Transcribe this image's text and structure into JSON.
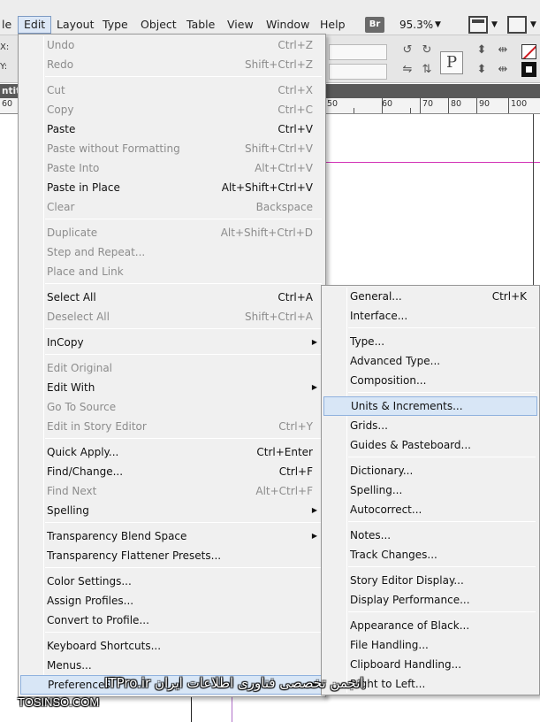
{
  "menubar": {
    "items": [
      {
        "label": "le",
        "active": false
      },
      {
        "label": "Edit",
        "active": true
      },
      {
        "label": "Layout",
        "active": false
      },
      {
        "label": "Type",
        "active": false
      },
      {
        "label": "Object",
        "active": false
      },
      {
        "label": "Table",
        "active": false
      },
      {
        "label": "View",
        "active": false
      },
      {
        "label": "Window",
        "active": false
      },
      {
        "label": "Help",
        "active": false
      }
    ],
    "bridge_badge": "Br",
    "zoom": "95.3%",
    "zoom_caret": "▼",
    "view_options_icon": "view-options-icon",
    "screen_mode_icon": "screen-mode-icon"
  },
  "control_panel": {
    "x_label": "X:",
    "y_label": "Y:",
    "fill_swatch_icon": "fill-none-icon",
    "stroke_swatch_icon": "stroke-black-icon",
    "paragraph_icon": "P"
  },
  "document": {
    "tab_label": "ntitle",
    "ruler_labels": [
      "60",
      "50",
      "60",
      "70",
      "80",
      "90",
      "100"
    ]
  },
  "edit_menu": {
    "items": [
      {
        "label": "Undo",
        "shortcut": "Ctrl+Z",
        "enabled": false
      },
      {
        "label": "Redo",
        "shortcut": "Shift+Ctrl+Z",
        "enabled": false
      },
      {
        "sep": true
      },
      {
        "label": "Cut",
        "shortcut": "Ctrl+X",
        "enabled": false
      },
      {
        "label": "Copy",
        "shortcut": "Ctrl+C",
        "enabled": false
      },
      {
        "label": "Paste",
        "shortcut": "Ctrl+V",
        "enabled": true
      },
      {
        "label": "Paste without Formatting",
        "shortcut": "Shift+Ctrl+V",
        "enabled": false
      },
      {
        "label": "Paste Into",
        "shortcut": "Alt+Ctrl+V",
        "enabled": false
      },
      {
        "label": "Paste in Place",
        "shortcut": "Alt+Shift+Ctrl+V",
        "enabled": true
      },
      {
        "label": "Clear",
        "shortcut": "Backspace",
        "enabled": false
      },
      {
        "sep": true
      },
      {
        "label": "Duplicate",
        "shortcut": "Alt+Shift+Ctrl+D",
        "enabled": false
      },
      {
        "label": "Step and Repeat...",
        "shortcut": "",
        "enabled": false
      },
      {
        "label": "Place and Link",
        "shortcut": "",
        "enabled": false
      },
      {
        "sep": true
      },
      {
        "label": "Select All",
        "shortcut": "Ctrl+A",
        "enabled": true
      },
      {
        "label": "Deselect All",
        "shortcut": "Shift+Ctrl+A",
        "enabled": false
      },
      {
        "sep": true
      },
      {
        "label": "InCopy",
        "shortcut": "",
        "enabled": true,
        "submenu": true
      },
      {
        "sep": true
      },
      {
        "label": "Edit Original",
        "shortcut": "",
        "enabled": false
      },
      {
        "label": "Edit With",
        "shortcut": "",
        "enabled": true,
        "submenu": true
      },
      {
        "label": "Go To Source",
        "shortcut": "",
        "enabled": false
      },
      {
        "label": "Edit in Story Editor",
        "shortcut": "Ctrl+Y",
        "enabled": false
      },
      {
        "sep": true
      },
      {
        "label": "Quick Apply...",
        "shortcut": "Ctrl+Enter",
        "enabled": true
      },
      {
        "label": "Find/Change...",
        "shortcut": "Ctrl+F",
        "enabled": true
      },
      {
        "label": "Find Next",
        "shortcut": "Alt+Ctrl+F",
        "enabled": false
      },
      {
        "label": "Spelling",
        "shortcut": "",
        "enabled": true,
        "submenu": true
      },
      {
        "sep": true
      },
      {
        "label": "Transparency Blend Space",
        "shortcut": "",
        "enabled": true,
        "submenu": true
      },
      {
        "label": "Transparency Flattener Presets...",
        "shortcut": "",
        "enabled": true
      },
      {
        "sep": true
      },
      {
        "label": "Color Settings...",
        "shortcut": "",
        "enabled": true
      },
      {
        "label": "Assign Profiles...",
        "shortcut": "",
        "enabled": true
      },
      {
        "label": "Convert to Profile...",
        "shortcut": "",
        "enabled": true
      },
      {
        "sep": true
      },
      {
        "label": "Keyboard Shortcuts...",
        "shortcut": "",
        "enabled": true
      },
      {
        "label": "Menus...",
        "shortcut": "",
        "enabled": true
      },
      {
        "label": "Preferences",
        "shortcut": "",
        "enabled": true,
        "submenu": true,
        "highlight": true
      }
    ]
  },
  "prefs_menu": {
    "items": [
      {
        "label": "General...",
        "shortcut": "Ctrl+K"
      },
      {
        "label": "Interface...",
        "shortcut": ""
      },
      {
        "sep": true
      },
      {
        "label": "Type...",
        "shortcut": ""
      },
      {
        "label": "Advanced Type...",
        "shortcut": ""
      },
      {
        "label": "Composition...",
        "shortcut": ""
      },
      {
        "sep": true
      },
      {
        "label": "Units & Increments...",
        "shortcut": "",
        "highlight": true
      },
      {
        "label": "Grids...",
        "shortcut": ""
      },
      {
        "label": "Guides & Pasteboard...",
        "shortcut": ""
      },
      {
        "sep": true
      },
      {
        "label": "Dictionary...",
        "shortcut": ""
      },
      {
        "label": "Spelling...",
        "shortcut": ""
      },
      {
        "label": "Autocorrect...",
        "shortcut": ""
      },
      {
        "sep": true
      },
      {
        "label": "Notes...",
        "shortcut": ""
      },
      {
        "label": "Track Changes...",
        "shortcut": ""
      },
      {
        "sep": true
      },
      {
        "label": "Story Editor Display...",
        "shortcut": ""
      },
      {
        "label": "Display Performance...",
        "shortcut": ""
      },
      {
        "sep": true
      },
      {
        "label": "Appearance of Black...",
        "shortcut": ""
      },
      {
        "label": "File Handling...",
        "shortcut": ""
      },
      {
        "label": "Clipboard Handling...",
        "shortcut": ""
      },
      {
        "label": "Right to Left...",
        "shortcut": ""
      }
    ]
  },
  "watermark": {
    "text": "انجمن تخصصی فناوری اطلاعات ایران ITPro.ir",
    "site": "TOSINSO.COM"
  }
}
